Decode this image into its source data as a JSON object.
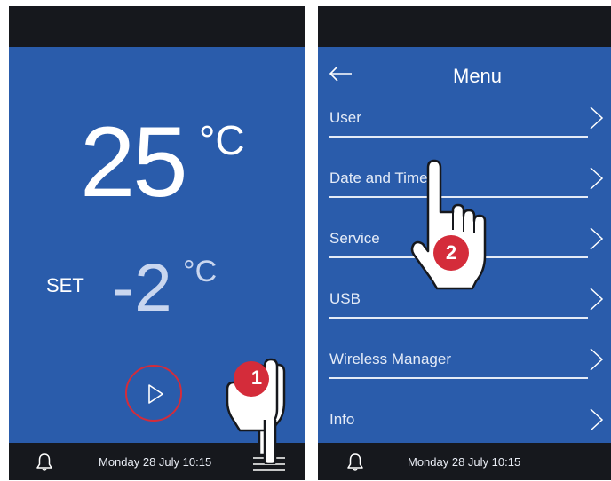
{
  "screen1": {
    "temperature": "25",
    "temperature_unit": "°C",
    "set_label": "SET",
    "set_value": "-2",
    "set_unit": "°C",
    "footer_datetime": "Monday 28 July 10:15",
    "step_badge": "1"
  },
  "screen2": {
    "title": "Menu",
    "menu_items": [
      {
        "label": "User"
      },
      {
        "label": "Date and Time"
      },
      {
        "label": "Service"
      },
      {
        "label": "USB"
      },
      {
        "label": "Wireless Manager"
      },
      {
        "label": "Info"
      }
    ],
    "footer_datetime": "Monday 28 July 10:15",
    "step_badge": "2"
  },
  "colors": {
    "screen_bg": "#2a5cab",
    "bar_bg": "#16181d",
    "accent_red": "#d42c3a",
    "text": "#ffffff",
    "set_text": "#c9d6ef"
  },
  "icons": [
    "bell-icon",
    "play-icon",
    "menu-icon",
    "back-arrow-icon",
    "chevron-right-icon",
    "pointing-hand-icon"
  ]
}
